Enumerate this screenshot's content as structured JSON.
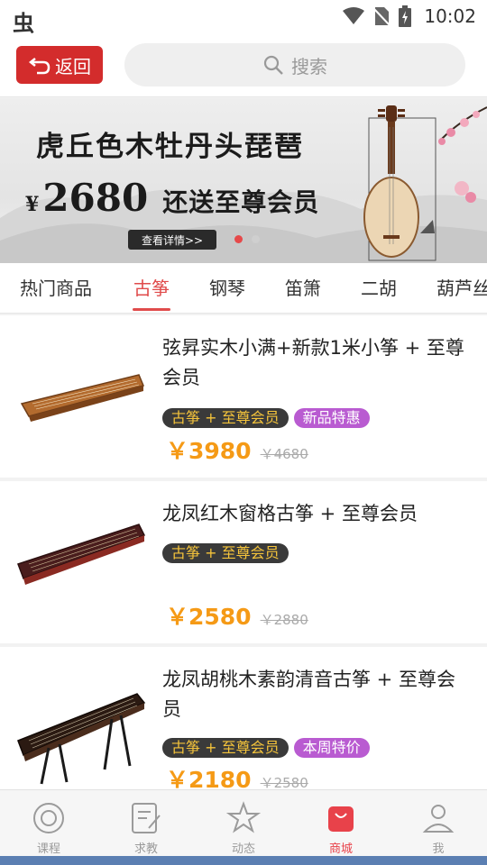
{
  "status_bar": {
    "time": "10:02",
    "app_glyph": "虫"
  },
  "top_bar": {
    "back_label": "返回",
    "search_placeholder": "搜索"
  },
  "banner": {
    "title": "虎丘色木牡丹头琵琶",
    "currency": "¥",
    "price": "2680",
    "promo": "还送至尊会员",
    "detail_button": "查看详情>>",
    "page_count": 2,
    "active_page": 1
  },
  "category_tabs": [
    {
      "label": "热门商品",
      "active": false
    },
    {
      "label": "古筝",
      "active": true
    },
    {
      "label": "钢琴",
      "active": false
    },
    {
      "label": "笛箫",
      "active": false
    },
    {
      "label": "二胡",
      "active": false
    },
    {
      "label": "葫芦丝",
      "active": false
    }
  ],
  "products": [
    {
      "name": "弦昇实木小满+新款1米小筝 + 至尊会员",
      "tags": [
        "古筝 + 至尊会员",
        "新品特惠"
      ],
      "price": "￥3980",
      "old_price": "￥4680"
    },
    {
      "name": "龙凤红木窗格古筝 + 至尊会员",
      "tags": [
        "古筝 + 至尊会员"
      ],
      "price": "￥2580",
      "old_price": "￥2880"
    },
    {
      "name": "龙凤胡桃木素韵清音古筝 + 至尊会员",
      "tags": [
        "古筝 + 至尊会员",
        "本周特价"
      ],
      "price": "￥2180",
      "old_price": "￥2580"
    }
  ],
  "bottom_nav": [
    {
      "label": "课程",
      "icon": "disc-icon",
      "active": false
    },
    {
      "label": "求教",
      "icon": "edit-note-icon",
      "active": false
    },
    {
      "label": "动态",
      "icon": "star-icon",
      "active": false
    },
    {
      "label": "商城",
      "icon": "shopping-bag-icon",
      "active": true
    },
    {
      "label": "我",
      "icon": "user-icon",
      "active": false
    }
  ],
  "colors": {
    "accent": "#e04b4b",
    "price": "#f59a16",
    "back_button": "#d32c2c"
  }
}
